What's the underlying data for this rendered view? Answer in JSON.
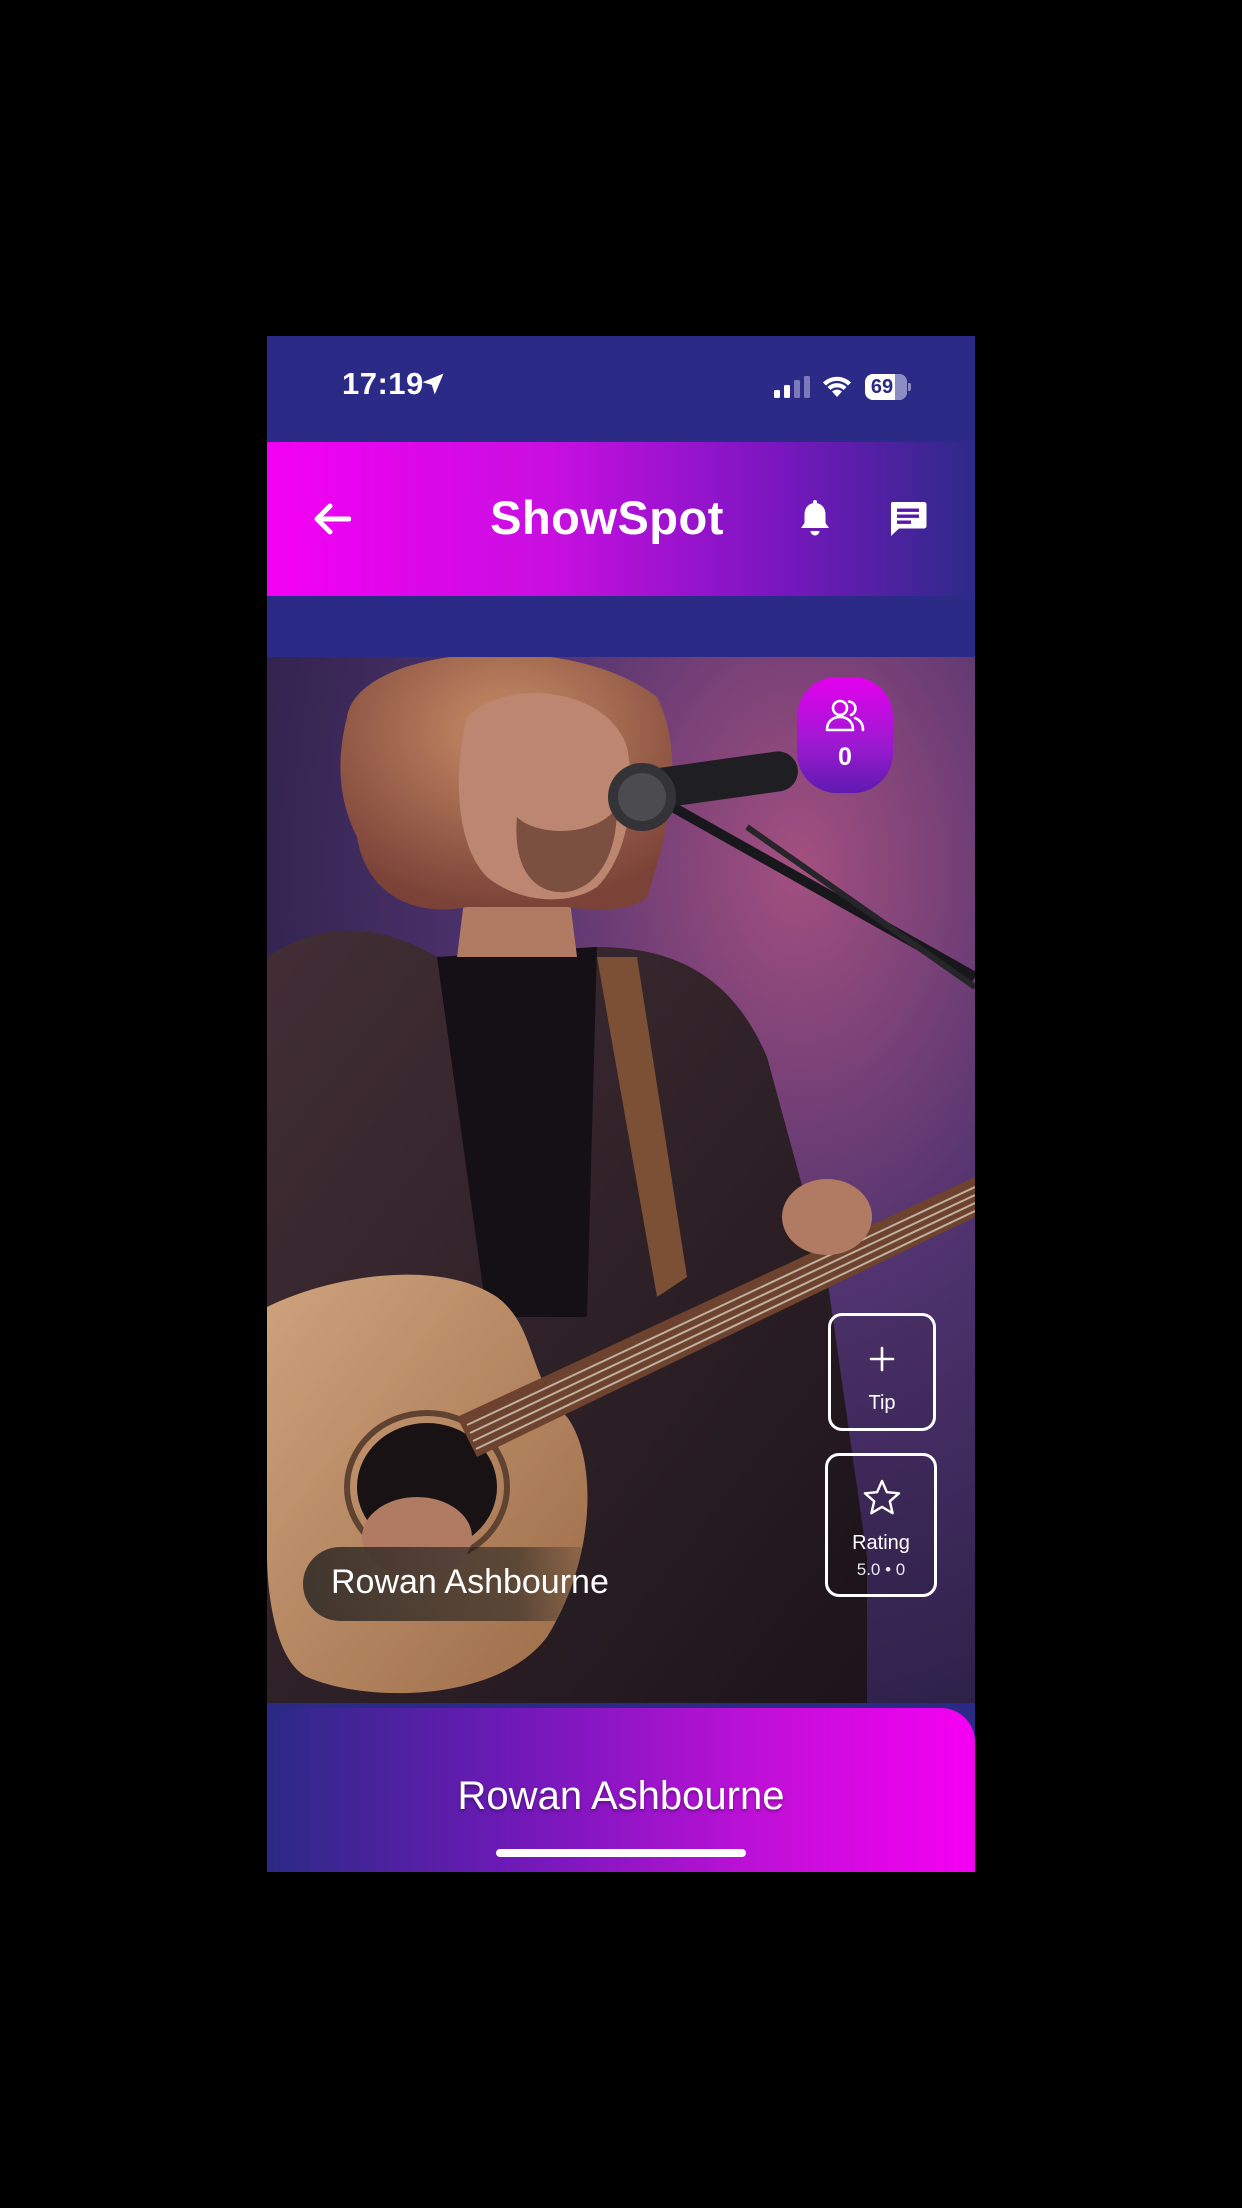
{
  "status_bar": {
    "time": "17:19",
    "battery": "69",
    "location_icon": "location-arrow-icon",
    "signal_icon": "cellular-signal-icon",
    "wifi_icon": "wifi-icon"
  },
  "header": {
    "title": "ShowSpot",
    "back_icon": "arrow-left-icon",
    "notifications_icon": "bell-icon",
    "messages_icon": "chat-icon",
    "gradient": [
      "#f400f4",
      "#2c2a88"
    ]
  },
  "performer": {
    "name": "Rowan Ashbourne",
    "viewers": {
      "icon": "users-icon",
      "count": "0"
    },
    "tip": {
      "icon": "plus-icon",
      "label": "Tip"
    },
    "rating": {
      "icon": "star-icon",
      "label": "Rating",
      "detail": "5.0 • 0"
    }
  },
  "bottom_sheet": {
    "title": "Rowan Ashbourne"
  },
  "colors": {
    "background": "#2b2a86",
    "accent": "#f400f4"
  }
}
